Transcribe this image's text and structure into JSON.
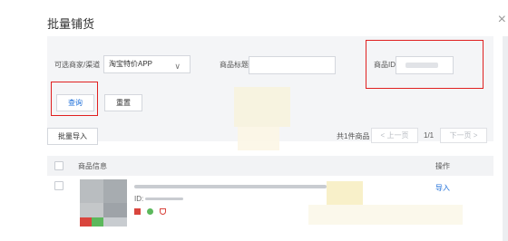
{
  "dialog": {
    "title": "批量铺货",
    "close_glyph": "×"
  },
  "filters": {
    "channel_label": "可选商家/渠道",
    "channel_value": "淘宝特价APP",
    "title_label": "商品标题",
    "title_value": "",
    "id_label": "商品ID",
    "id_value": ""
  },
  "actions": {
    "query_label": "查询",
    "reset_label": "重置",
    "import_label": "批量导入"
  },
  "pager": {
    "total_text": "共1件商品",
    "prev_label": "< 上一页",
    "page_text": "1/1",
    "next_label": "下一页 >"
  },
  "table": {
    "headers": {
      "info": "商品信息",
      "ops": "操作"
    },
    "rows": [
      {
        "id_prefix": "ID:",
        "action": "导入"
      }
    ]
  },
  "colors": {
    "accent": "#1e6fd9",
    "highlight": "#e02020",
    "panel": "#f4f5f7"
  },
  "icons": {
    "close": "close-icon",
    "chevron": "chevron-down-icon"
  }
}
